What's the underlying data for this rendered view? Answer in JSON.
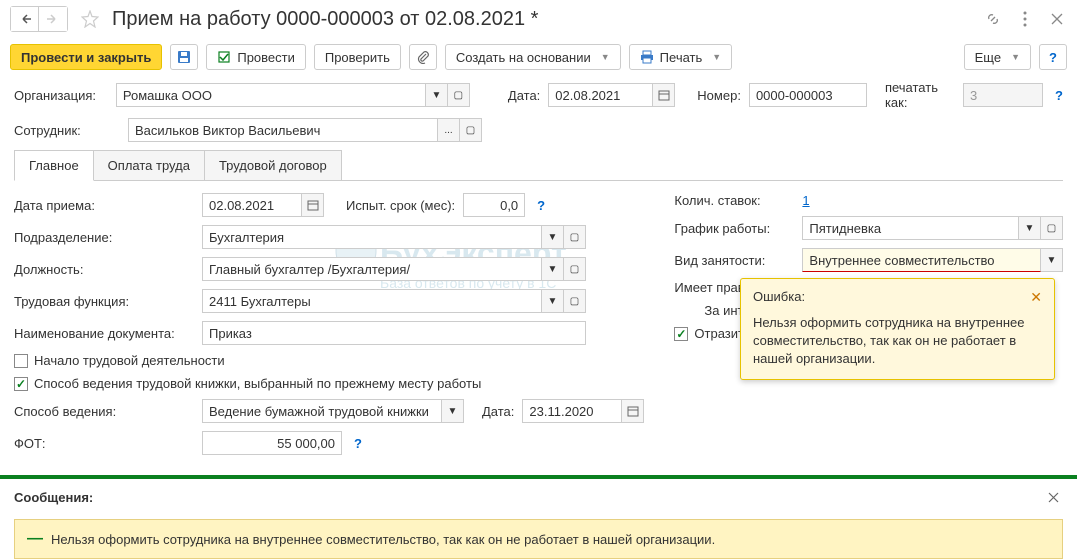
{
  "header": {
    "title": "Прием на работу 0000-000003 от 02.08.2021 *"
  },
  "toolbar": {
    "post_close": "Провести и закрыть",
    "post": "Провести",
    "check": "Проверить",
    "create_based": "Создать на основании",
    "print": "Печать",
    "more": "Еще"
  },
  "form": {
    "org_label": "Организация:",
    "org_value": "Ромашка ООО",
    "date_label": "Дата:",
    "date_value": "02.08.2021",
    "number_label": "Номер:",
    "number_value": "0000-000003",
    "print_as_label": "печатать как:",
    "print_as_value": "3",
    "employee_label": "Сотрудник:",
    "employee_value": "Васильков Виктор Васильевич"
  },
  "tabs": {
    "main": "Главное",
    "payment": "Оплата труда",
    "contract": "Трудовой договор"
  },
  "main_tab": {
    "hire_date_label": "Дата приема:",
    "hire_date_value": "02.08.2021",
    "probation_label": "Испыт. срок (мес):",
    "probation_value": "0,0",
    "department_label": "Подразделение:",
    "department_value": "Бухгалтерия",
    "position_label": "Должность:",
    "position_value": "Главный бухгалтер /Бухгалтерия/",
    "function_label": "Трудовая функция:",
    "function_value": "2411 Бухгалтеры",
    "doc_name_label": "Наименование документа:",
    "doc_name_value": "Приказ",
    "start_work_label": "Начало трудовой деятельности",
    "book_method_label": "Способ ведения трудовой книжки, выбранный по прежнему месту работы",
    "method_label": "Способ ведения:",
    "method_value": "Ведение бумажной трудовой книжки",
    "method_date_label": "Дата:",
    "method_date_value": "23.11.2020",
    "fot_label": "ФОТ:",
    "fot_value": "55 000,00",
    "rate_count_label": "Колич. ставок:",
    "rate_count_value": "1",
    "schedule_label": "График работы:",
    "schedule_value": "Пятидневка",
    "employment_type_label": "Вид занятости:",
    "employment_type_value": "Внутреннее совместительство",
    "right_label": "Имеет право на еже",
    "intensive_label": "За интенсивный тру",
    "reflect_label": "Отразить в труд"
  },
  "tooltip": {
    "title": "Ошибка:",
    "body": "Нельзя оформить сотрудника на внутреннее совместительство, так как он не работает в нашей организации."
  },
  "messages": {
    "header": "Сообщения:",
    "msg1": "Нельзя оформить сотрудника на внутреннее совместительство, так как он не работает в нашей организации."
  }
}
